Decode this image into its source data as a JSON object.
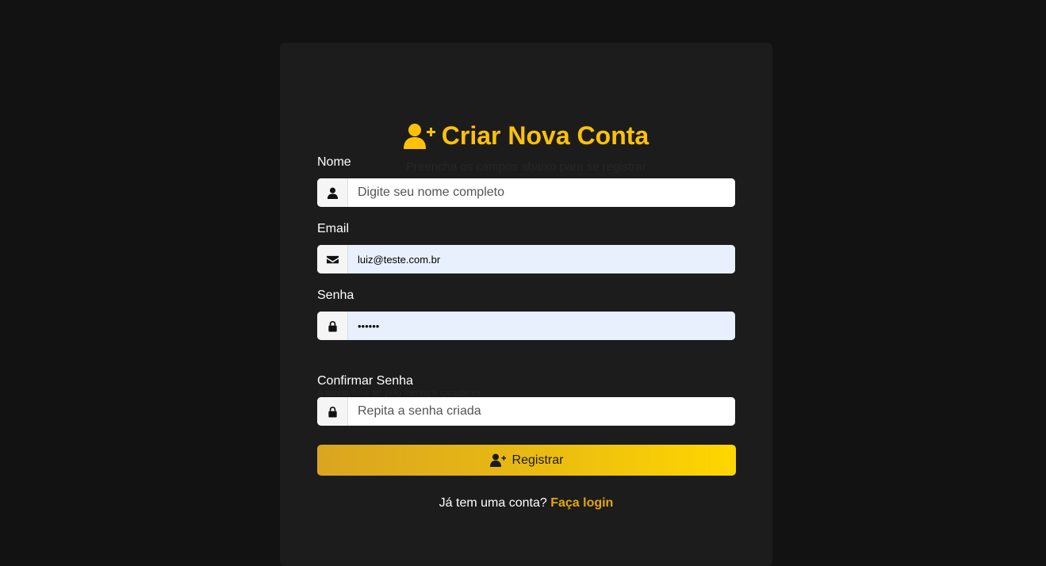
{
  "form": {
    "title": "Criar Nova Conta",
    "subtitle": "Preencha os campos abaixo para se registrar",
    "title_icon": "user-plus-icon",
    "accent_color": "#ffc107",
    "fields": {
      "name": {
        "label": "Nome",
        "placeholder": "Digite seu nome completo",
        "value": "",
        "icon": "user-icon"
      },
      "email": {
        "label": "Email",
        "placeholder": "",
        "value": "luiz@teste.com.br",
        "icon": "envelope-icon"
      },
      "password": {
        "label": "Senha",
        "placeholder": "",
        "value": "••••••",
        "icon": "lock-icon",
        "hint": "A senha deve ter pelo menos 6 caracteres"
      },
      "confirm": {
        "label": "Confirmar Senha",
        "placeholder": "Repita a senha criada",
        "value": "",
        "icon": "lock-icon"
      }
    },
    "submit_label": "Registrar",
    "footer_text": "Já tem uma conta?",
    "login_link": "Faça login"
  }
}
